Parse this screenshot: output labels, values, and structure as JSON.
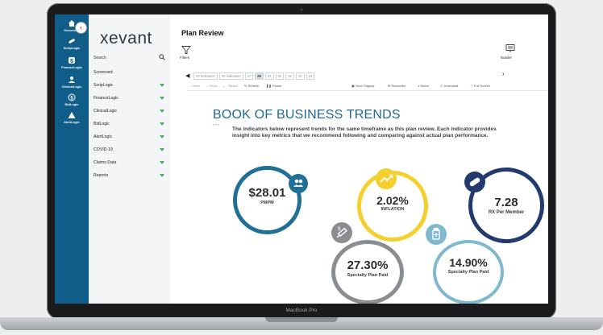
{
  "device": {
    "label": "MacBook Pro"
  },
  "rail": {
    "items": [
      {
        "label": "Scorecard",
        "icon": "home-icon"
      },
      {
        "label": "ScripLogic",
        "icon": "pill-icon"
      },
      {
        "label": "FinanceLogic",
        "icon": "dollar-icon"
      },
      {
        "label": "ClinicalLogic",
        "icon": "person-icon"
      },
      {
        "label": "BidLogic",
        "icon": "bid-icon"
      },
      {
        "label": "AlertLogic",
        "icon": "alert-icon"
      }
    ]
  },
  "nav": {
    "logo": "xevant",
    "search_label": "Search",
    "items": [
      {
        "label": "Scorecard",
        "expandable": false
      },
      {
        "label": "ScripLogic",
        "expandable": true
      },
      {
        "label": "FinanceLogic",
        "expandable": true
      },
      {
        "label": "ClinicalLogic",
        "expandable": true
      },
      {
        "label": "BidLogic",
        "expandable": true
      },
      {
        "label": "AlertLogic",
        "expandable": true
      },
      {
        "label": "COVID-19",
        "expandable": true
      },
      {
        "label": "Claims Data",
        "expandable": true
      },
      {
        "label": "Reports",
        "expandable": true
      }
    ]
  },
  "main": {
    "title": "Plan Review",
    "filters_label": "Filters",
    "builder_label": "Builder",
    "pager": {
      "items": [
        "#2 Indication",
        "#3 Indication",
        "27",
        "28",
        "29",
        "30",
        "32",
        "33",
        "34"
      ],
      "active": "28"
    },
    "toolbar": {
      "undo": "Undo",
      "redo": "Redo",
      "revert": "Revert",
      "refresh": "Refresh",
      "pause": "Pause",
      "view_original": "View Original",
      "subscribe": "Subscribe",
      "share": "Share",
      "download": "Download",
      "fullscreen": "Full Screen"
    }
  },
  "report": {
    "title": "BOOK OF BUSINESS TRENDS",
    "intro": "The indicators below represent trends for the same timeframe as this plan review. Each indicator provides insight into key metrics that we recommend following and comparing against actual plan performance.",
    "kpis": [
      {
        "value": "$28.01",
        "label": "PMPM",
        "color": "#1f6f96",
        "icon": "people-money-icon"
      },
      {
        "value": "2.02%",
        "label": "INFLATION",
        "color": "#f4cf2e",
        "icon": "trend-up-icon"
      },
      {
        "value": "7.28",
        "label": "RX Per Member",
        "color": "#233a6f",
        "icon": "pill-icon"
      },
      {
        "value": "27.30%",
        "label": "Specialty Plan Paid",
        "color": "#8a8e92",
        "icon": "syringe-icon"
      },
      {
        "value": "14.90%",
        "label": "Specialty Plan Paid",
        "color": "#7fb8cf",
        "icon": "medicine-bottle-icon"
      }
    ]
  }
}
